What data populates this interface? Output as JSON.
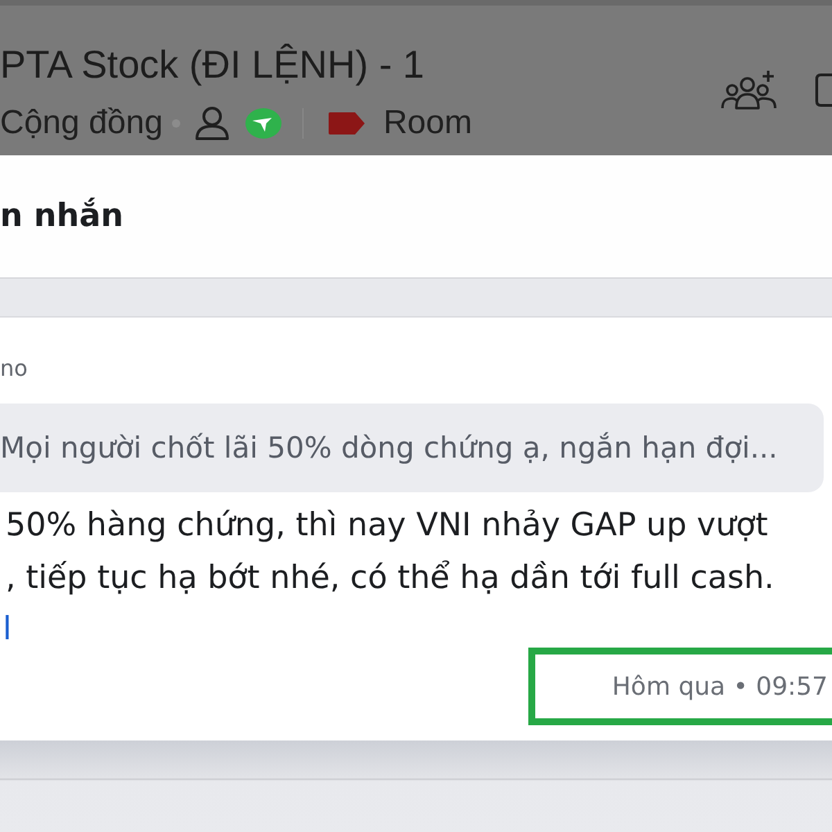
{
  "header": {
    "title": "PTA Stock (ĐI LỆNH) - 1",
    "category": "Cộng đồng",
    "tag": "Room"
  },
  "panel": {
    "title": "n nhắn"
  },
  "message": {
    "sender": "no",
    "quote": "Mọi người chốt lãi 50% dòng chứng ạ, ngắn hạn đợi...",
    "body_lines": [
      "50% hàng chứng, thì nay VNI nhảy GAP up vượt",
      ", tiếp tục hạ bớt nhé, có thể hạ dần tới full cash."
    ],
    "link": "l",
    "timestamp": "Hôm qua • 09:57",
    "highlighted": true
  }
}
